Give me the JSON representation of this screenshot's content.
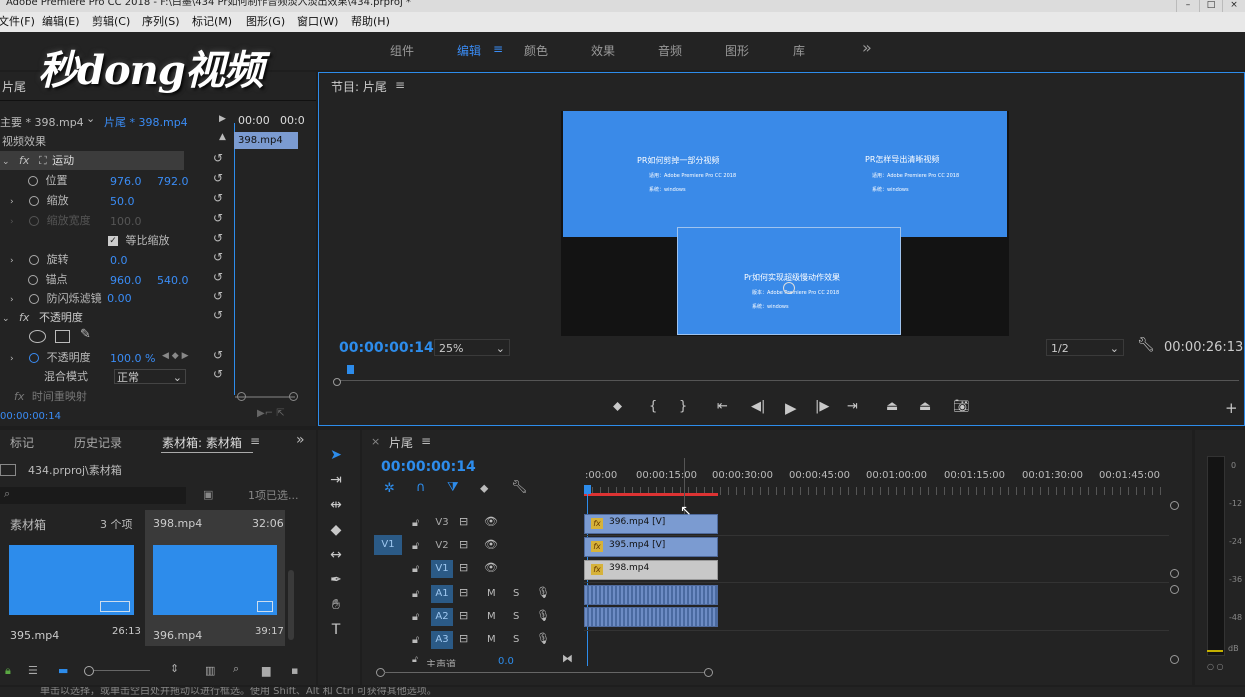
{
  "window": {
    "title": "Adobe Premiere Pro CC 2018 - F:\\白墨\\434 Pr如何制作音频淡入淡出效果\\434.prproj *"
  },
  "menu": [
    "文件(F)",
    "编辑(E)",
    "剪辑(C)",
    "序列(S)",
    "标记(M)",
    "图形(G)",
    "窗口(W)",
    "帮助(H)"
  ],
  "logo": "秒dong视频",
  "workspaces": {
    "items": [
      "组件",
      "编辑",
      "颜色",
      "效果",
      "音频",
      "图形",
      "库"
    ],
    "active": "编辑",
    "more": "»"
  },
  "effect_controls": {
    "panel_tab": "片尾",
    "master": "主要 * 398.mp4",
    "clip": "片尾 * 398.mp4",
    "timecodes": [
      "00:00",
      "00:0"
    ],
    "mini_clip": "398.mp4",
    "section_video": "视频效果",
    "motion": "运动",
    "position_label": "位置",
    "position_x": "976.0",
    "position_y": "792.0",
    "scale_label": "缩放",
    "scale_value": "50.0",
    "scale_width_label": "缩放宽度",
    "scale_width_value": "100.0",
    "uniform_scale": "等比缩放",
    "rotation_label": "旋转",
    "rotation_value": "0.0",
    "anchor_label": "锚点",
    "anchor_x": "960.0",
    "anchor_y": "540.0",
    "antiflicker_label": "防闪烁滤镜",
    "antiflicker_value": "0.00",
    "opacity_section": "不透明度",
    "opacity_label": "不透明度",
    "opacity_value": "100.0 %",
    "blend_label": "混合模式",
    "blend_value": "正常",
    "time_remap": "时间重映射",
    "current_time": "00:00:00:14"
  },
  "program_monitor": {
    "title": "节目: 片尾",
    "timecode": "00:00:00:14",
    "zoom": "25%",
    "resolution": "1/2",
    "duration": "00:00:26:13",
    "frame": {
      "left_title": "PR如何剪掉一部分视频",
      "left_line1": "适用：Adobe Premiere Pro CC 2018",
      "left_line2": "系统：windows",
      "right_title": "PR怎样导出清晰视频",
      "right_line1": "适用：Adobe Premiere Pro CC 2018",
      "right_line2": "系统：windows",
      "center_title": "Pr如何实现超级慢动作效果",
      "center_line1": "版本：Adobe Premiere Pro CC 2018",
      "center_line2": "系统：windows"
    }
  },
  "project_panel": {
    "tabs": [
      "标记",
      "历史记录",
      "素材箱: 素材箱"
    ],
    "active_tab": "素材箱: 素材箱",
    "path": "434.prproj\\素材箱",
    "selection": "1项已选...",
    "bin_label": "素材箱",
    "bin_count": "3 个项",
    "items": [
      {
        "name": "398.mp4",
        "duration": "32:06"
      },
      {
        "name": "395.mp4",
        "duration": "26:13"
      },
      {
        "name": "396.mp4",
        "duration": "39:17"
      }
    ]
  },
  "timeline": {
    "tab": "片尾",
    "timecode": "00:00:00:14",
    "ruler": [
      ":00:00",
      "00:00:15:00",
      "00:00:30:00",
      "00:00:45:00",
      "00:01:00:00",
      "00:01:15:00",
      "00:01:30:00",
      "00:01:45:00"
    ],
    "video_tracks": [
      "V3",
      "V2",
      "V1"
    ],
    "audio_tracks": [
      "A1",
      "A2",
      "A3"
    ],
    "source_patch": "V1",
    "mute": "M",
    "solo": "S",
    "master": "主声道",
    "master_value": "0.0",
    "clips": [
      "396.mp4 [V]",
      "395.mp4 [V]",
      "398.mp4"
    ]
  },
  "audio_meter": {
    "ticks": [
      "0",
      "-12",
      "-24",
      "-36",
      "-48",
      "dB"
    ]
  },
  "status_bar": "单击以选择，或单击空白处并拖动以进行框选。使用 Shift、Alt 和 Ctrl 可获得其他选项。",
  "colors": {
    "accent_blue": "#2d8ceb",
    "clip_blue": "#7b9bd1",
    "clip_gray": "#c8c8c8",
    "panel_bg": "#232323",
    "frame_blue": "#3a8ae8"
  }
}
